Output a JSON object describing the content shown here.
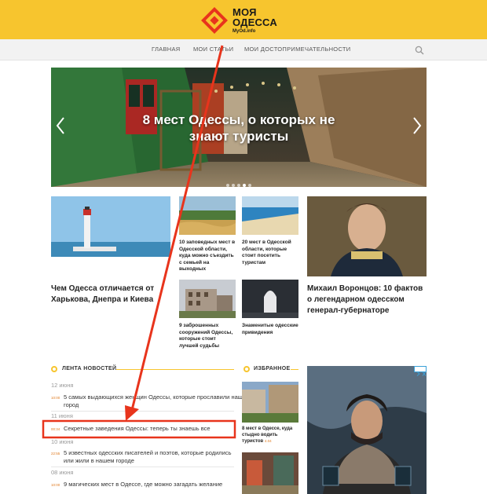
{
  "site": {
    "logo_line1": "МОЯ",
    "logo_line2": "ОДЕССА",
    "logo_domain": "MyOd.info"
  },
  "nav": [
    {
      "label": "ГЛАВНАЯ"
    },
    {
      "label": "МОИ СТАТЬИ"
    },
    {
      "label": "МОИ ДОСТОПРИМЕЧАТЕЛЬНОСТИ"
    }
  ],
  "hero": {
    "title": "8 мест Одессы, о которых не знают туристы"
  },
  "cards": {
    "big_left": {
      "title": "Чем Одесса отличается от Харькова, Днепра и Киева"
    },
    "small_1": {
      "title": "10 заповедных мест в Одесской области, куда можно съездить с семьей на выходных"
    },
    "small_2": {
      "title": "20 мест в Одесской области, которые стоит посетить туристам"
    },
    "small_3": {
      "title": "9 заброшенных сооружений Одессы, которые стоит лучшей судьбы"
    },
    "small_4": {
      "title": "Знаменитые одесские привидения"
    },
    "big_right": {
      "title": "Михаил Воронцов: 10 фактов о легендарном одесском генерал-губернаторе"
    }
  },
  "news_feed": {
    "heading": "ЛЕНТА НОВОСТЕЙ",
    "date1": "12 июня",
    "item1": {
      "time": "10:00",
      "text": "5 самых выдающихся женщин Одессы, которые прославили наш город"
    },
    "date2": "11 июня",
    "item2": {
      "time": "00:34",
      "text": "Секретные заведения Одессы: теперь ты знаешь все"
    },
    "date3": "10 июня",
    "item3": {
      "time": "22:55",
      "text": "5 известных одесских писателей и поэтов, которые родились или жили в нашем городе"
    },
    "date4": "08 июня",
    "item4": {
      "time": "10:00",
      "text": "9 магических мест в Одессе, где можно загадать желание"
    }
  },
  "favorites": {
    "heading": "ИЗБРАННОЕ",
    "item1": {
      "title": "8 мест в Одессе, куда стыдно водить туристов",
      "date": "4.04"
    }
  },
  "colors": {
    "brand_yellow": "#f7c52e",
    "highlight_red": "#e8341c",
    "time_orange": "#e07b20"
  }
}
